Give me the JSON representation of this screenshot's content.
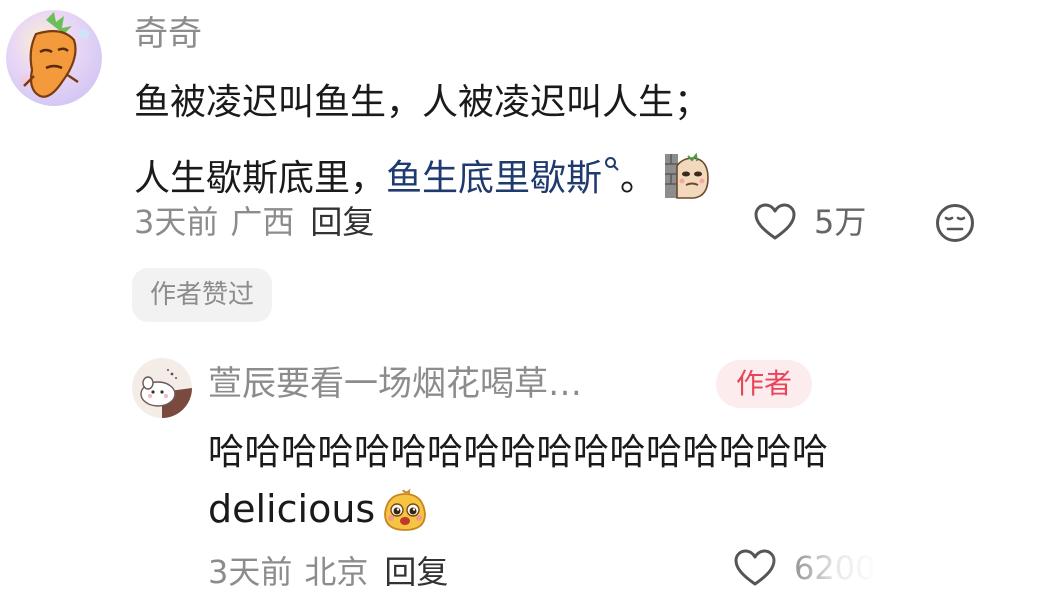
{
  "main_comment": {
    "username": "奇奇",
    "avatar_icon": "carrot-character-avatar",
    "text_line1": "鱼被凌迟叫鱼生，人被凌迟叫人生；",
    "text_line2_plain": "人生歇斯底里，",
    "text_line2_link": "鱼生底里歇斯",
    "text_line2_end": "。",
    "link_color": "#1f3a6e",
    "search_icon": "search-icon",
    "sticker": "peeking-potato-sticker",
    "time": "3天前",
    "location": "广西",
    "reply_label": "回复",
    "like_count": "5万",
    "author_liked_label": "作者赞过"
  },
  "reply": {
    "username": "萱辰要看一场烟花喝草…",
    "avatar_icon": "hamster-avatar",
    "author_badge": "作者",
    "badge_color": "#e8455a",
    "text_line1": "哈哈哈哈哈哈哈哈哈哈哈哈哈哈哈哈哈",
    "text_line2": "delicious",
    "emoji": "drooling-face-emoji",
    "time": "3天前",
    "location": "北京",
    "reply_label": "回复",
    "like_count": "6200"
  }
}
